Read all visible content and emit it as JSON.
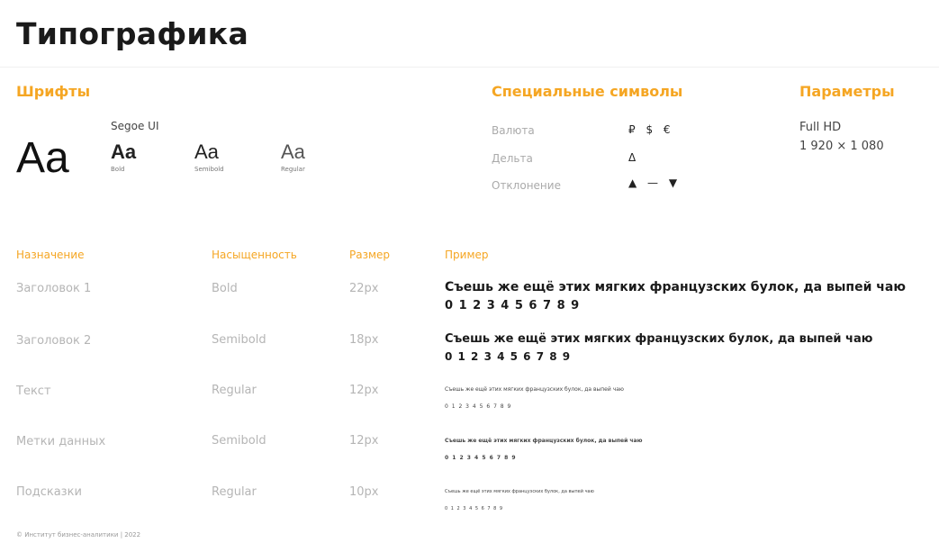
{
  "title": "Типографика",
  "fonts": {
    "heading": "Шрифты",
    "font_name": "Segoe UI",
    "big_sample": "Aa",
    "samples": [
      {
        "text": "Aa",
        "label": "Bold"
      },
      {
        "text": "Aa",
        "label": "Semibold"
      },
      {
        "text": "Aa",
        "label": "Regular"
      }
    ]
  },
  "special": {
    "heading": "Специальные символы",
    "rows": [
      {
        "label": "Валюта",
        "value": "₽ $ €"
      },
      {
        "label": "Дельта",
        "value": "Δ"
      },
      {
        "label": "Отклонение",
        "value": "▲ — ▼"
      }
    ]
  },
  "params": {
    "heading": "Параметры",
    "line1": "Full HD",
    "line2": "1 920 × 1 080"
  },
  "table": {
    "headers": [
      "Назначение",
      "Насыщенность",
      "Размер",
      "Пример"
    ],
    "rows": [
      {
        "purpose": "Заголовок 1",
        "weight": "Bold",
        "size": "22px",
        "example": "Съешь же ещё этих мягких французских булок, да выпей чаю",
        "digits": "0 1 2 3 4 5 6 7 8 9"
      },
      {
        "purpose": "Заголовок 2",
        "weight": "Semibold",
        "size": "18px",
        "example": "Съешь же ещё этих мягких французских булок, да выпей чаю",
        "digits": "0 1 2 3 4 5 6 7 8 9"
      },
      {
        "purpose": "Текст",
        "weight": "Regular",
        "size": "12px",
        "example": "Съешь же ещё этих мягких французских булок, да выпей чаю",
        "digits": "0 1 2 3 4 5 6 7 8 9"
      },
      {
        "purpose": "Метки данных",
        "weight": "Semibold",
        "size": "12px",
        "example": "Съешь же ещё этих мягких французских булок, да выпей чаю",
        "digits": "0 1 2 3 4 5 6 7 8 9"
      },
      {
        "purpose": "Подсказки",
        "weight": "Regular",
        "size": "10px",
        "example": "Съешь же ещё этих мягких французских булок, да выпей чаю",
        "digits": "0 1 2 3 4 5 6 7 8 9"
      }
    ]
  },
  "footer": "© Институт бизнес-аналитики | 2022"
}
